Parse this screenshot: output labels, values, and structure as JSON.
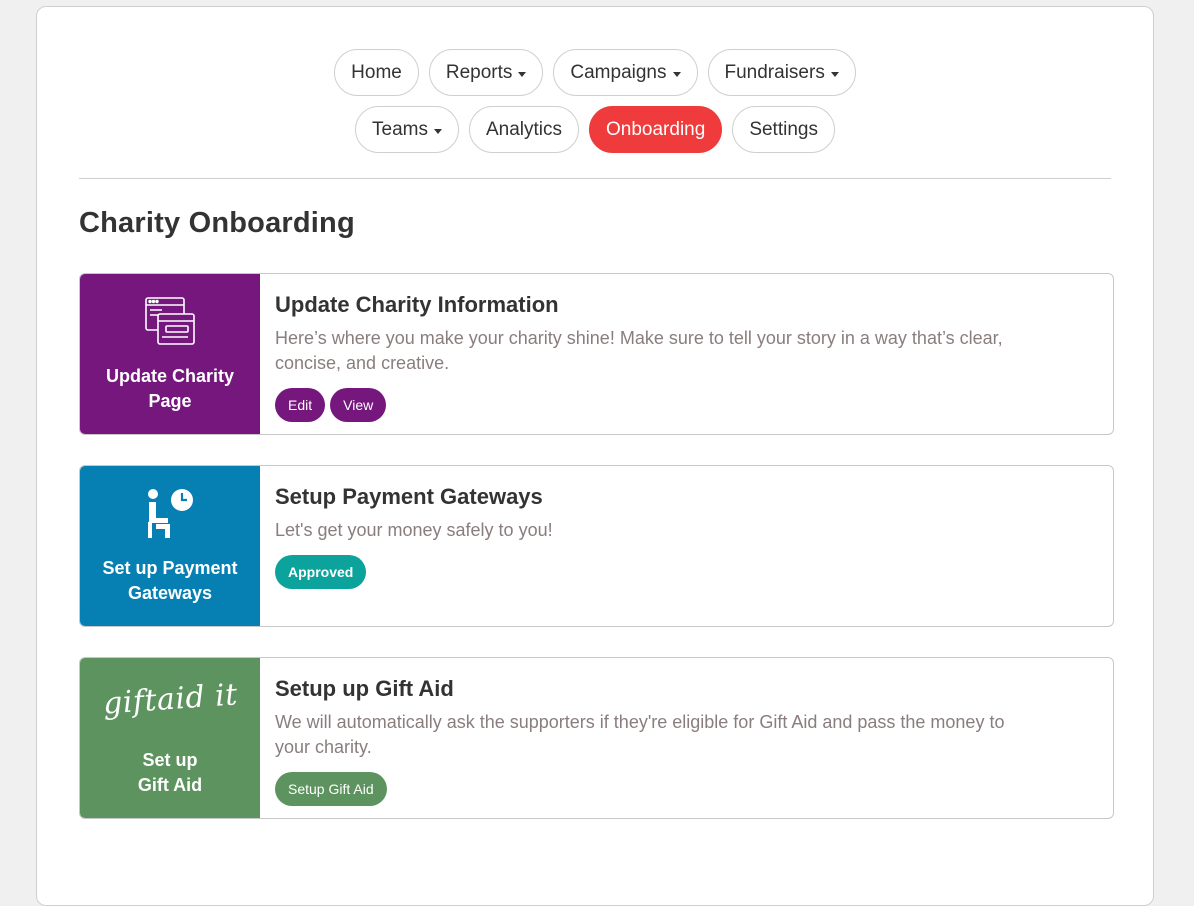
{
  "nav": {
    "row1": [
      {
        "label": "Home",
        "dropdown": false
      },
      {
        "label": "Reports",
        "dropdown": true
      },
      {
        "label": "Campaigns",
        "dropdown": true
      },
      {
        "label": "Fundraisers",
        "dropdown": true
      }
    ],
    "row2": [
      {
        "label": "Teams",
        "dropdown": true
      },
      {
        "label": "Analytics",
        "dropdown": false
      },
      {
        "label": "Onboarding",
        "dropdown": false,
        "active": true
      },
      {
        "label": "Settings",
        "dropdown": false
      }
    ],
    "active_color": "#ef3b3b"
  },
  "page": {
    "title": "Charity Onboarding"
  },
  "cards": [
    {
      "tile_label": "Update Charity\nPage",
      "tile_icon": "webpage-icon",
      "tile_color": "#75177c",
      "title": "Update Charity Information",
      "description": "Here’s where you make your charity shine! Make sure to tell your story in a way that’s clear, concise, and creative.",
      "buttons": [
        "Edit",
        "View"
      ]
    },
    {
      "tile_label": "Set up Payment\nGateways",
      "tile_icon": "person-clock-icon",
      "tile_color": "#0680b3",
      "title": "Setup Payment Gateways",
      "description": "Let's get your money safely to you!",
      "status": "Approved",
      "status_color": "#0ca39c"
    },
    {
      "tile_label": "Set up\nGift Aid",
      "tile_logo": "giftaid it",
      "tile_color": "#5d935e",
      "title": "Setup up Gift Aid",
      "description": "We will automatically ask the supporters if they're eligible for Gift Aid and pass the money to your charity.",
      "buttons": [
        "Setup Gift Aid"
      ]
    }
  ]
}
